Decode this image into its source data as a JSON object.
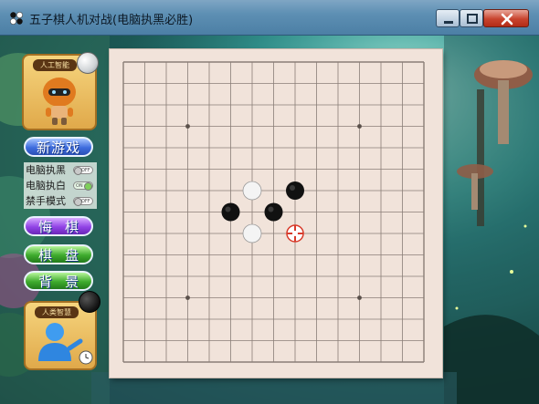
{
  "window": {
    "title": "五子棋人机对战(电脑执黑必胜)",
    "controls": [
      "minimize",
      "maximize",
      "close"
    ]
  },
  "sidebar": {
    "ai_card_label": "人工智能",
    "new_game_label": "新游戏",
    "options": [
      {
        "label": "电脑执黑",
        "toggle_text": "OFF",
        "state": "off"
      },
      {
        "label": "电脑执白",
        "toggle_text": "ON",
        "state": "on"
      },
      {
        "label": "禁手模式",
        "toggle_text": "OFF",
        "state": "off"
      }
    ],
    "undo_label": "悔棋",
    "board_label": "棋盘",
    "background_label": "背景",
    "human_card_label": "人类智慧"
  },
  "board": {
    "grid_lines": 15,
    "star_points": [
      [
        3,
        3
      ],
      [
        11,
        3
      ],
      [
        3,
        11
      ],
      [
        11,
        11
      ]
    ],
    "stones": [
      {
        "col": 6,
        "row": 6,
        "color": "white"
      },
      {
        "col": 8,
        "row": 6,
        "color": "black"
      },
      {
        "col": 5,
        "row": 7,
        "color": "black"
      },
      {
        "col": 7,
        "row": 7,
        "color": "black"
      },
      {
        "col": 6,
        "row": 8,
        "color": "white"
      }
    ],
    "cursor": {
      "col": 8,
      "row": 8
    },
    "colors": {
      "surface": "#f1e3da",
      "line": "#8a7e77",
      "black": "#111111",
      "white": "#f4f4f4",
      "cursor": "#d83a2a"
    }
  }
}
